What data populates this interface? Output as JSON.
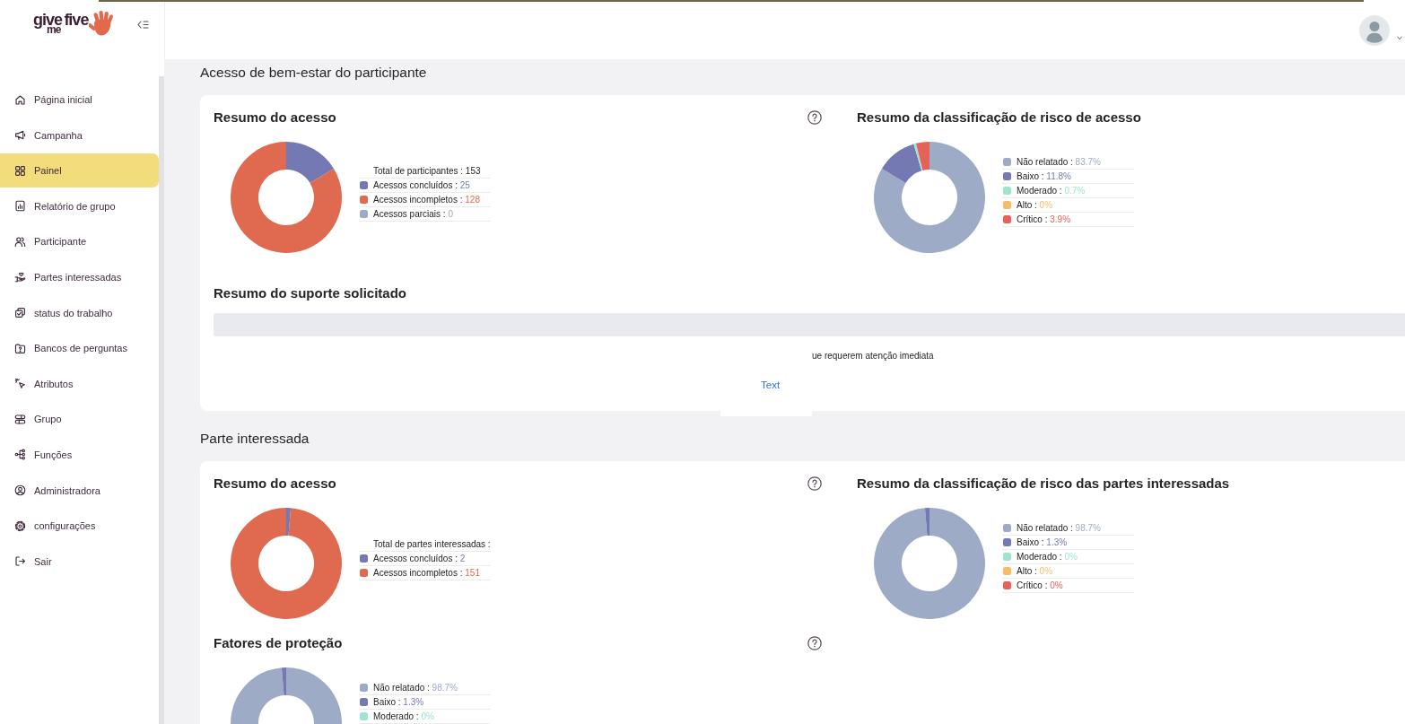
{
  "logo": {
    "words": [
      "give",
      "me",
      "five"
    ]
  },
  "sidebar": {
    "items": [
      {
        "label": "Página inicial",
        "selected": false
      },
      {
        "label": "Campanha",
        "selected": false
      },
      {
        "label": "Painel",
        "selected": true
      },
      {
        "label": "Relatório de grupo",
        "selected": false
      },
      {
        "label": "Participante",
        "selected": false
      },
      {
        "label": "Partes interessadas",
        "selected": false
      },
      {
        "label": "status do trabalho",
        "selected": false
      },
      {
        "label": "Bancos de perguntas",
        "selected": false
      },
      {
        "label": "Atributos",
        "selected": false
      },
      {
        "label": "Grupo",
        "selected": false
      },
      {
        "label": "Funções",
        "selected": false
      },
      {
        "label": "Administradora",
        "selected": false
      },
      {
        "label": "configurações",
        "selected": false
      },
      {
        "label": "Sair",
        "selected": false
      }
    ]
  },
  "sections": [
    {
      "title": "Acesso de bem-estar do participante",
      "charts": [
        {
          "title": "Resumo do acesso",
          "help": true,
          "total": "Total de participantes : 153",
          "separator": ":",
          "legend_values": [
            "25",
            "128",
            "0"
          ],
          "chart_data": {
            "type": "donut",
            "categories": [
              "Acessos concluídos",
              "Acessos incompletos",
              "Acessos parciais"
            ],
            "values": [
              16.34,
              83.66,
              0
            ],
            "colors": [
              "#7479b3",
              "#df6a4f",
              "#9eabc6"
            ]
          }
        },
        {
          "title": "Resumo da classificação de risco de acesso",
          "help": false,
          "separator": ":",
          "legend_values": [
            "83.7%",
            "11.8%",
            "0.7%",
            "0%",
            "3.9%"
          ],
          "chart_data": {
            "type": "donut",
            "categories": [
              "Não relatado",
              "Baixo",
              "Moderado",
              "Alto",
              "Crítico"
            ],
            "values": [
              83.7,
              11.8,
              0.7,
              0,
              3.9
            ],
            "colors": [
              "#9eabc6",
              "#7479b3",
              "#a0e3d0",
              "#f4bd6a",
              "#e4625a"
            ]
          }
        }
      ],
      "support": {
        "title": "Resumo do suporte solicitado",
        "note": "ue requerem atenção imediata",
        "link": "Text"
      }
    },
    {
      "title": "Parte interessada",
      "charts": [
        {
          "title": "Resumo do acesso",
          "help": true,
          "total": "Total de partes interessadas :",
          "separator": ":",
          "legend_values": [
            "2",
            "151"
          ],
          "chart_data": {
            "type": "donut",
            "categories": [
              "Acessos concluídos",
              "Acessos incompletos"
            ],
            "values": [
              1.31,
              98.69
            ],
            "colors": [
              "#7479b3",
              "#df6a4f"
            ]
          }
        },
        {
          "title": "Resumo da classificação de risco das partes interessadas",
          "help": false,
          "separator": ":",
          "legend_values": [
            "98.7%",
            "1.3%",
            "0%",
            "0%",
            "0%"
          ],
          "chart_data": {
            "type": "donut",
            "categories": [
              "Não relatado",
              "Baixo",
              "Moderado",
              "Alto",
              "Crítico"
            ],
            "values": [
              98.7,
              1.3,
              0,
              0,
              0
            ],
            "colors": [
              "#9eabc6",
              "#7479b3",
              "#a0e3d0",
              "#f4bd6a",
              "#e4625a"
            ]
          }
        },
        {
          "title": "Fatores de proteção",
          "help": true,
          "separator": ":",
          "legend_values": [
            "98.7%",
            "1.3%",
            "0%"
          ],
          "chart_data": {
            "type": "donut",
            "categories": [
              "Não relatado",
              "Baixo",
              "Moderado"
            ],
            "values": [
              98.7,
              1.3,
              0
            ],
            "colors": [
              "#9eabc6",
              "#7479b3",
              "#a0e3d0"
            ]
          }
        }
      ]
    }
  ]
}
